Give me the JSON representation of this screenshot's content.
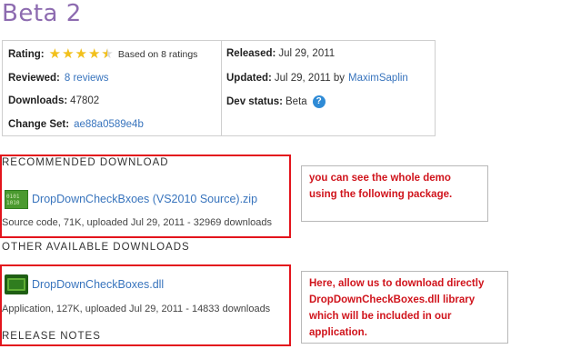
{
  "page_title": "Beta 2",
  "info": {
    "rating_label": "Rating:",
    "rating_value": 4.5,
    "rating_max": 5,
    "rating_text": "Based on 8 ratings",
    "reviewed_label": "Reviewed:",
    "reviewed_value": "8 reviews",
    "downloads_label": "Downloads:",
    "downloads_value": "47802",
    "changeset_label": "Change Set:",
    "changeset_value": "ae88a0589e4b",
    "released_label": "Released:",
    "released_value": "Jul 29, 2011",
    "updated_label": "Updated:",
    "updated_value": "Jul 29, 2011 by",
    "updated_by": "MaximSaplin",
    "devstatus_label": "Dev status:",
    "devstatus_value": "Beta",
    "help_glyph": "?"
  },
  "recommended": {
    "heading": "RECOMMENDED DOWNLOAD",
    "file_name": "DropDownCheckBxoes (VS2010 Source).zip",
    "meta": "Source code, 71K, uploaded Jul 29, 2011 - 32969 downloads",
    "icon": "zip-file-icon"
  },
  "other": {
    "heading": "OTHER AVAILABLE DOWNLOADS",
    "file_name": "DropDownCheckBoxes.dll",
    "meta": "Application, 127K, uploaded Jul 29, 2011 - 14833 downloads",
    "icon": "dll-file-icon"
  },
  "release_notes": {
    "heading": "RELEASE NOTES"
  },
  "callouts": {
    "first": "you can see the whole demo using the following package.",
    "second": "Here, allow us to download  directly DropDownCheckBoxes.dll library which will be included in our application."
  },
  "colors": {
    "title": "#8d6bb0",
    "link": "#3874bd",
    "annotation_red": "#e3141c",
    "star": "#f2c01b"
  }
}
